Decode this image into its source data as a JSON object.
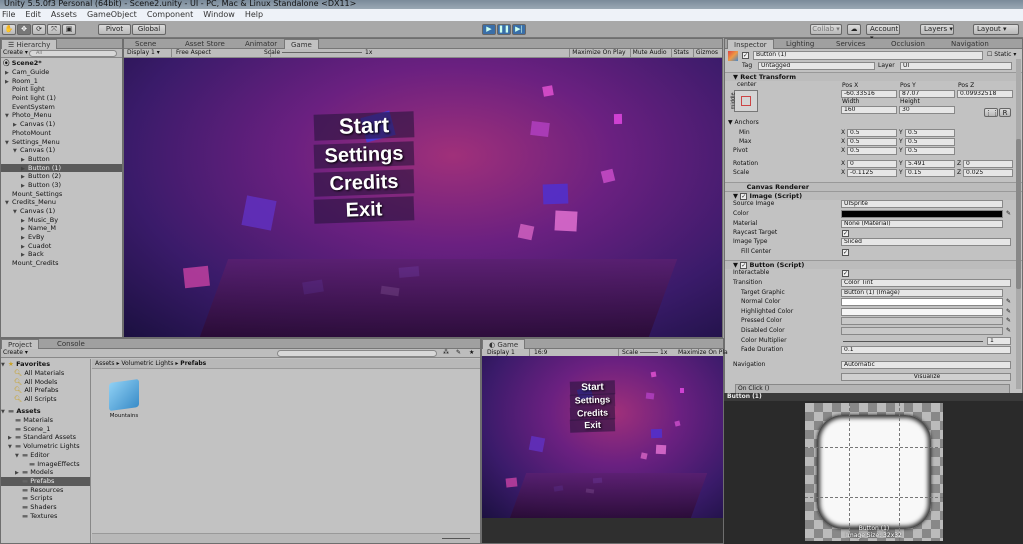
{
  "window": {
    "title": "Unity 5.5.0f3 Personal (64bit) - Scene2.unity - UI - PC, Mac & Linux Standalone <DX11>"
  },
  "menu": [
    "File",
    "Edit",
    "Assets",
    "GameObject",
    "Component",
    "Window",
    "Help"
  ],
  "toolbar": {
    "pivot": "Pivot",
    "global": "Global",
    "collab": "Collab",
    "account": "Account",
    "layers": "Layers",
    "layout": "Layout"
  },
  "hierarchy": {
    "tab": "Hierarchy",
    "create": "Create",
    "search_placeholder": "All",
    "scene": "Scene2*",
    "items": [
      {
        "label": "Cam_Guide",
        "depth": 0,
        "arrow": "▶"
      },
      {
        "label": "Room_1",
        "depth": 0,
        "arrow": "▶"
      },
      {
        "label": "Point light",
        "depth": 0,
        "arrow": ""
      },
      {
        "label": "Point light (1)",
        "depth": 0,
        "arrow": ""
      },
      {
        "label": "EventSystem",
        "depth": 0,
        "arrow": ""
      },
      {
        "label": "Photo_Menu",
        "depth": 0,
        "arrow": "▼"
      },
      {
        "label": "Canvas (1)",
        "depth": 1,
        "arrow": "▶"
      },
      {
        "label": "PhotoMount",
        "depth": 0,
        "arrow": ""
      },
      {
        "label": "Settings_Menu",
        "depth": 0,
        "arrow": "▼"
      },
      {
        "label": "Canvas (1)",
        "depth": 1,
        "arrow": "▼"
      },
      {
        "label": "Button",
        "depth": 2,
        "arrow": "▶"
      },
      {
        "label": "Button (1)",
        "depth": 2,
        "arrow": "▶",
        "selected": true
      },
      {
        "label": "Button (2)",
        "depth": 2,
        "arrow": "▶"
      },
      {
        "label": "Button (3)",
        "depth": 2,
        "arrow": "▶"
      },
      {
        "label": "Mount_Settings",
        "depth": 0,
        "arrow": ""
      },
      {
        "label": "Credits_Menu",
        "depth": 0,
        "arrow": "▼"
      },
      {
        "label": "Canvas (1)",
        "depth": 1,
        "arrow": "▼"
      },
      {
        "label": "Music_By",
        "depth": 2,
        "arrow": "▶"
      },
      {
        "label": "Name_M",
        "depth": 2,
        "arrow": "▶"
      },
      {
        "label": "EvBy",
        "depth": 2,
        "arrow": "▶"
      },
      {
        "label": "Cuadot",
        "depth": 2,
        "arrow": "▶"
      },
      {
        "label": "Back",
        "depth": 2,
        "arrow": "▶"
      },
      {
        "label": "Mount_Credits",
        "depth": 0,
        "arrow": ""
      }
    ]
  },
  "center": {
    "tabs": [
      "Scene",
      "Asset Store",
      "Animator",
      "Game"
    ],
    "display": "Display 1",
    "aspect": "Free Aspect",
    "scale_label": "Scale",
    "scale_value": "1x",
    "buttons": [
      "Maximize On Play",
      "Mute Audio",
      "Stats",
      "Gizmos"
    ]
  },
  "game_menu": [
    "Start",
    "Settings",
    "Credits",
    "Exit"
  ],
  "inspector": {
    "tabs": [
      "Inspector",
      "Lighting",
      "Services",
      "Occlusion",
      "Navigation"
    ],
    "object_name": "Button (1)",
    "static": "Static",
    "tag_label": "Tag",
    "tag": "Untagged",
    "layer_label": "Layer",
    "layer": "UI",
    "rect": {
      "title": "Rect Transform",
      "anchor_h": "center",
      "anchor_v": "middle",
      "posx_l": "Pos X",
      "posy_l": "Pos Y",
      "posz_l": "Pos Z",
      "posx": "-60.33516",
      "posy": "87.07",
      "posz": "0.09932518",
      "width_l": "Width",
      "height_l": "Height",
      "width": "160",
      "height": "30",
      "r": "R",
      "anchors": "Anchors",
      "min": "Min",
      "max": "Max",
      "pivot": "Pivot",
      "min_x": "0.5",
      "min_y": "0.5",
      "max_x": "0.5",
      "max_y": "0.5",
      "pivot_x": "0.5",
      "pivot_y": "0.5",
      "rotation": "Rotation",
      "rot_x": "0",
      "rot_y": "5.491",
      "rot_z": "0",
      "scale": "Scale",
      "sc_x": "-0.1125",
      "sc_y": "0.15",
      "sc_z": "0.025",
      "X": "X",
      "Y": "Y",
      "Z": "Z"
    },
    "canvas_renderer": "Canvas Renderer",
    "image": {
      "title": "Image (Script)",
      "source_l": "Source Image",
      "source": "UISprite",
      "color_l": "Color",
      "material_l": "Material",
      "material": "None (Material)",
      "raycast_l": "Raycast Target",
      "type_l": "Image Type",
      "type": "Sliced",
      "fill_l": "Fill Center"
    },
    "button": {
      "title": "Button (Script)",
      "interactable_l": "Interactable",
      "transition_l": "Transition",
      "transition": "Color Tint",
      "target_l": "Target Graphic",
      "target": "Button (1) (Image)",
      "normal_l": "Normal Color",
      "highlighted_l": "Highlighted Color",
      "pressed_l": "Pressed Color",
      "disabled_l": "Disabled Color",
      "multiplier_l": "Color Multiplier",
      "multiplier": "1",
      "fade_l": "Fade Duration",
      "fade": "0.1",
      "navigation_l": "Navigation",
      "navigation": "Automatic",
      "visualize": "Visualize",
      "onclick": "On Click ()"
    }
  },
  "preview": {
    "title": "Button (1)",
    "caption1": "Button (1)",
    "caption2": "Image Size: 32x32"
  },
  "project": {
    "tabs": [
      "Project",
      "Console"
    ],
    "create": "Create",
    "breadcrumb": [
      "Assets",
      "Volumetric Lights",
      "Prefabs"
    ],
    "favorites": {
      "label": "Favorites",
      "items": [
        "All Materials",
        "All Models",
        "All Prefabs",
        "All Scripts"
      ]
    },
    "assets": {
      "label": "Assets",
      "items": [
        {
          "label": "Materials",
          "depth": 1,
          "arrow": ""
        },
        {
          "label": "Scene_1",
          "depth": 1,
          "arrow": ""
        },
        {
          "label": "Standard Assets",
          "depth": 1,
          "arrow": "▶"
        },
        {
          "label": "Volumetric Lights",
          "depth": 1,
          "arrow": "▼"
        },
        {
          "label": "Editor",
          "depth": 2,
          "arrow": "▼"
        },
        {
          "label": "ImageEffects",
          "depth": 3,
          "arrow": ""
        },
        {
          "label": "Models",
          "depth": 2,
          "arrow": "▶"
        },
        {
          "label": "Prefabs",
          "depth": 2,
          "arrow": "",
          "selected": true
        },
        {
          "label": "Resources",
          "depth": 2,
          "arrow": ""
        },
        {
          "label": "Scripts",
          "depth": 2,
          "arrow": ""
        },
        {
          "label": "Shaders",
          "depth": 2,
          "arrow": ""
        },
        {
          "label": "Textures",
          "depth": 2,
          "arrow": ""
        }
      ]
    },
    "files": [
      "Mountains"
    ]
  },
  "game2": {
    "tab": "Game",
    "display": "Display 1",
    "aspect": "16:9",
    "scale_label": "Scale",
    "scale_value": "1x",
    "maximize": "Maximize On Pla"
  }
}
